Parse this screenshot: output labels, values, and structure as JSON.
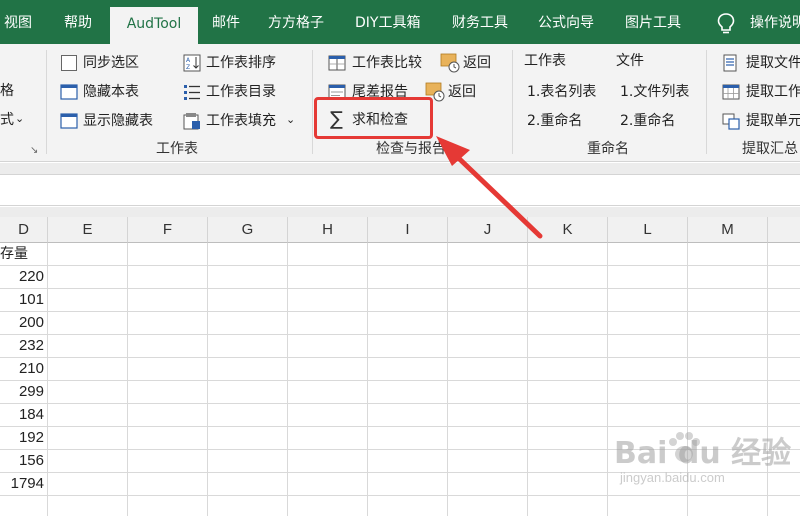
{
  "tabs": [
    {
      "label": "视图"
    },
    {
      "label": "帮助"
    },
    {
      "label": "AudTool"
    },
    {
      "label": "邮件"
    },
    {
      "label": "方方格子"
    },
    {
      "label": "DIY工具箱"
    },
    {
      "label": "财务工具"
    },
    {
      "label": "公式向导"
    },
    {
      "label": "图片工具"
    },
    {
      "label": "操作说明"
    }
  ],
  "ribbon": {
    "left_partial": {
      "item1": "格",
      "item2": "式"
    },
    "worksheet": {
      "sync_select": "同步选区",
      "hide_sheet": "隐藏本表",
      "show_hidden": "显示隐藏表",
      "sort_sheets": "工作表排序",
      "sheet_index": "工作表目录",
      "fill_sheet": "工作表填充",
      "group_label": "工作表"
    },
    "check_report": {
      "compare": "工作表比较",
      "return1": "返回",
      "tail_diff": "尾差报告",
      "return2": "返回",
      "sum_check": "求和检查",
      "group_label": "检查与报告"
    },
    "rename": {
      "sheets_header": "工作表",
      "sheets_list": "1.表名列表",
      "sheets_rename": "2.重命名",
      "files_header": "文件",
      "files_list": "1.文件列表",
      "files_rename": "2.重命名",
      "group_label": "重命名"
    },
    "extract": {
      "extract_file": "提取文件",
      "extract_sheet": "提取工作",
      "extract_cell": "提取单元",
      "group_label": "提取汇总"
    }
  },
  "sheet": {
    "columns": [
      "D",
      "E",
      "F",
      "G",
      "H",
      "I",
      "J",
      "K",
      "L",
      "M"
    ],
    "d_header": "存量",
    "d_values": [
      "220",
      "101",
      "200",
      "232",
      "210",
      "299",
      "184",
      "192",
      "156",
      "1794"
    ]
  },
  "watermark": {
    "brand": "Bai du 经验",
    "url": "jingyan.baidu.com"
  },
  "colors": {
    "accent": "#217346",
    "highlight": "#e53935"
  }
}
